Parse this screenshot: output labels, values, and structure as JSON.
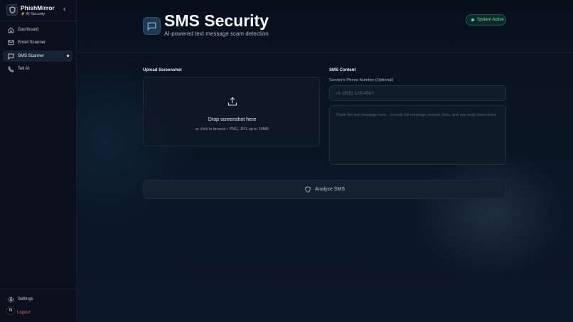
{
  "brand": {
    "name": "PhishMirror",
    "subtitle": "AI Security"
  },
  "sidebar": {
    "items": [
      {
        "label": "Dashboard",
        "icon": "home-icon"
      },
      {
        "label": "Email Scanner",
        "icon": "mail-icon"
      },
      {
        "label": "SMS Scanner",
        "icon": "message-square-icon",
        "active": true
      },
      {
        "label": "Tell AI",
        "icon": "phone-icon"
      }
    ],
    "footer": [
      {
        "label": "Settings",
        "icon": "gear-icon"
      },
      {
        "label": "Logout",
        "icon": "logout-icon"
      }
    ],
    "avatar_initial": "N"
  },
  "header": {
    "title": "SMS Security",
    "subtitle": "AI-powered text message scam detection",
    "status": "System Active"
  },
  "upload": {
    "section_label": "Upload Screenshot",
    "drop_title": "Drop screenshot here",
    "drop_hint": "or click to browse • PNG, JPG up to 10MB"
  },
  "sms": {
    "section_label": "SMS Content",
    "phone_label": "Sender's Phone Number (Optional)",
    "phone_placeholder": "+1 (555) 123-4567",
    "phone_value": "",
    "message_placeholder": "Paste the text message here... Include full message content, links, and any reply instructions",
    "message_value": ""
  },
  "actions": {
    "analyze_label": "Analyze SMS"
  },
  "colors": {
    "accent": "#2e5068",
    "status_green": "#3ee0a8",
    "logout_red": "#e0676b",
    "background": "#0b1322"
  }
}
